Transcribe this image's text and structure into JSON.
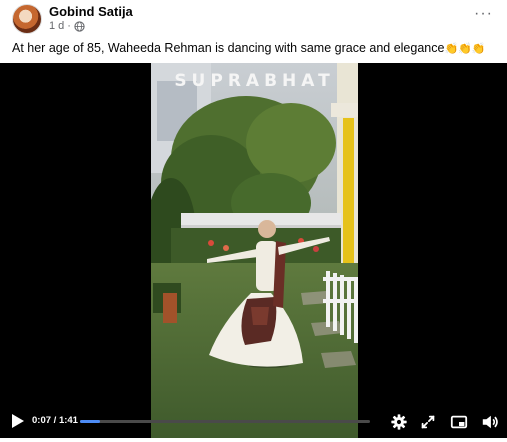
{
  "post": {
    "author": "Gobind Satija",
    "timestamp": "1 d",
    "meta_separator": "·",
    "privacy_icon": "globe-icon",
    "more_icon": "more-options-icon",
    "more_label": "···",
    "caption": "At her age of 85, Waheeda Rehman is dancing with same grace and elegance",
    "caption_emojis": "👏👏👏"
  },
  "video": {
    "watermark": "SUPRABHAT",
    "current_time": "0:07",
    "time_separator": " / ",
    "duration": "1:41",
    "progress": 0.069,
    "controls": [
      "play-icon",
      "settings-icon",
      "fullscreen-icon",
      "picture-in-picture-icon",
      "volume-icon"
    ]
  },
  "colors": {
    "progress_fill": "#4d8cf5",
    "video_bg": "#000000",
    "text_secondary": "#65676b"
  }
}
